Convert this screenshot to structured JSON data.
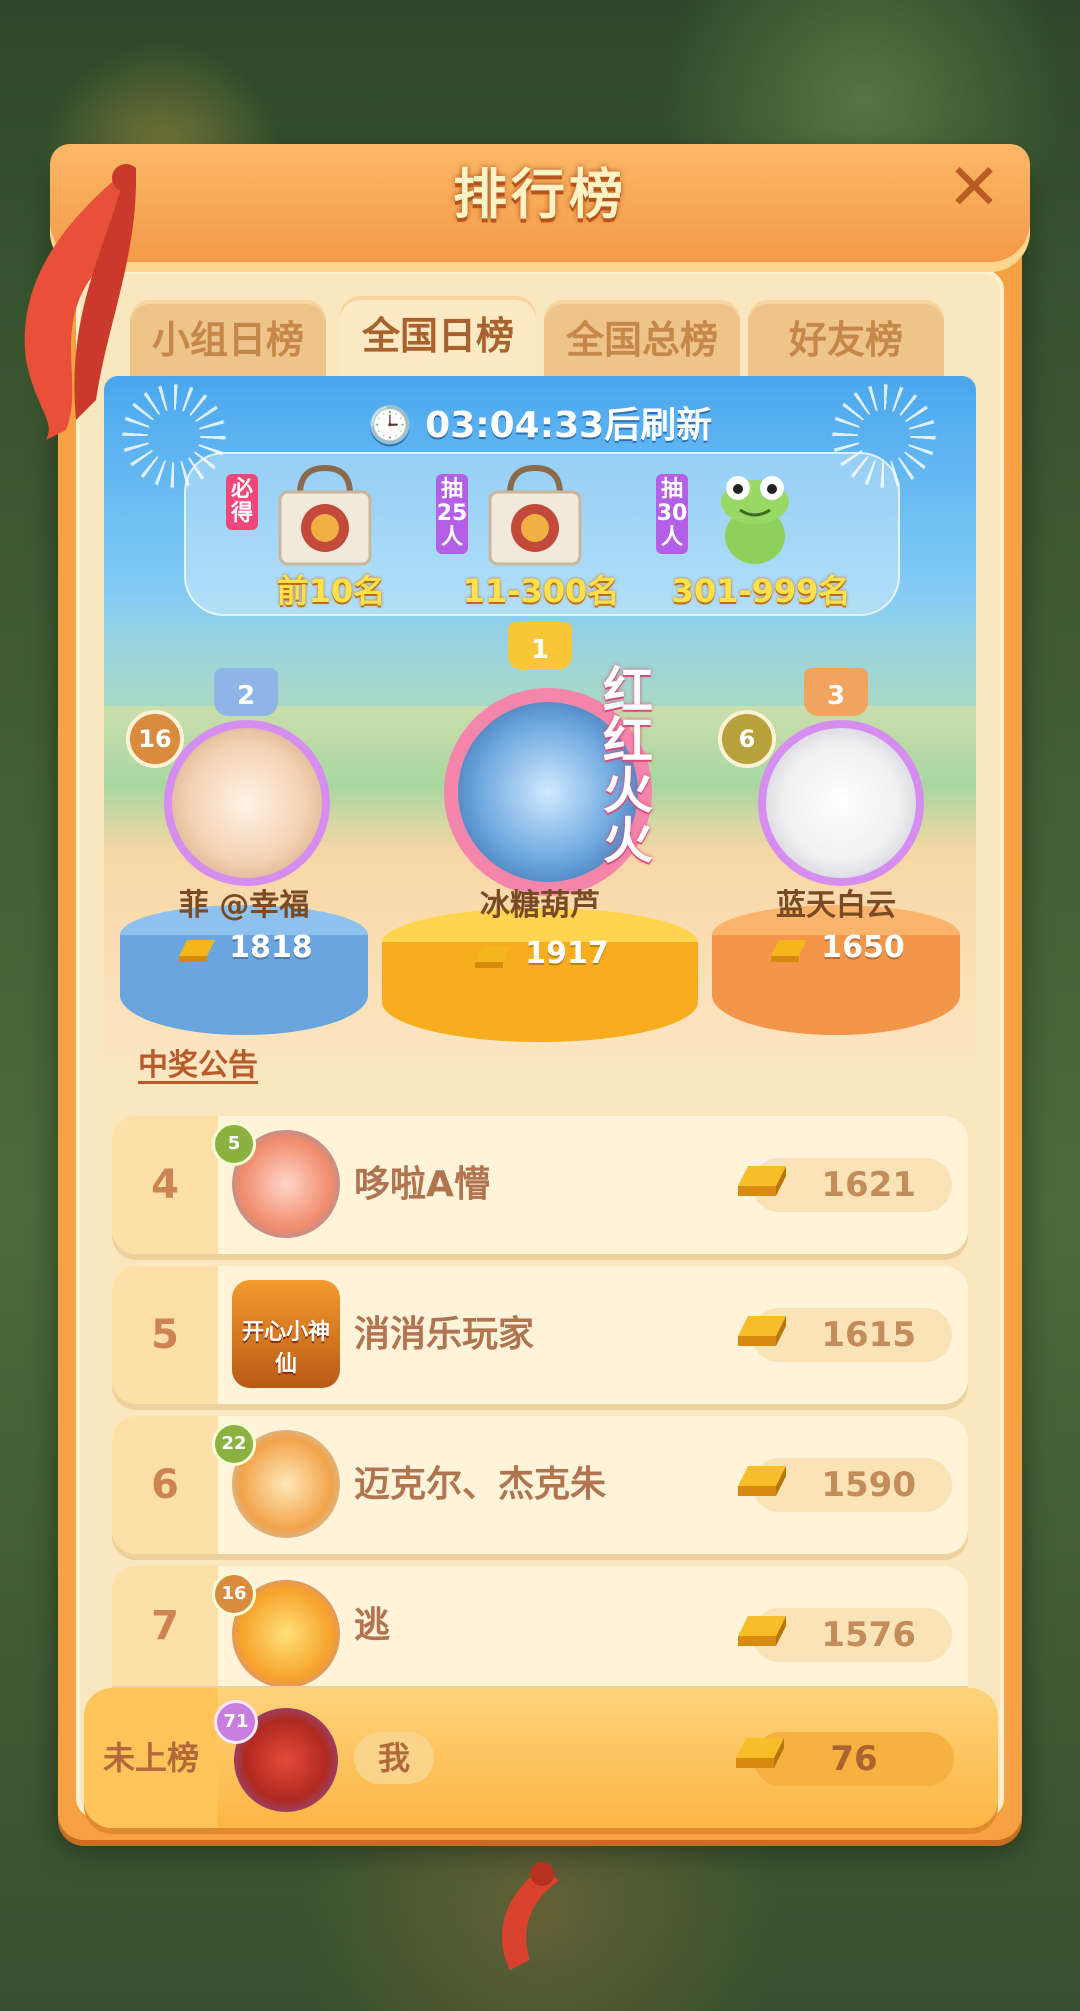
{
  "title": "排行榜",
  "tabs": [
    "小组日榜",
    "全国日榜",
    "全国总榜",
    "好友榜"
  ],
  "active_tab": "全国日榜",
  "refresh_timer": "03:04:33后刷新",
  "rewards": [
    {
      "tag": "必得",
      "label": "前10名",
      "item": "bag"
    },
    {
      "tag": "抽25人",
      "label": "11-300名",
      "item": "bag"
    },
    {
      "tag": "抽30人",
      "label": "301-999名",
      "item": "frog-plush"
    }
  ],
  "podium": [
    {
      "rank": "2",
      "level": "16",
      "name": "菲 @幸福",
      "score": "1818"
    },
    {
      "rank": "1",
      "name": "冰糖葫芦",
      "score": "1917",
      "frame_text": "红红火火"
    },
    {
      "rank": "3",
      "level": "6",
      "name": "蓝天白云",
      "score": "1650"
    }
  ],
  "notice_link": "中奖公告",
  "rows": [
    {
      "rank": "4",
      "level": "5",
      "name": "哆啦A懵",
      "score": "1621"
    },
    {
      "rank": "5",
      "level": "",
      "name": "消消乐玩家",
      "score": "1615",
      "avatar_text": "开心小神仙"
    },
    {
      "rank": "6",
      "level": "22",
      "name": "迈克尔、杰克朱",
      "score": "1590"
    },
    {
      "rank": "7",
      "level": "16",
      "name": "逃",
      "score": "1576"
    }
  ],
  "me": {
    "rank": "未上榜",
    "level": "71",
    "name": "我",
    "score": "76"
  },
  "colors": {
    "panel": "#f6a243",
    "accent_gold": "#ffe24a",
    "tab_active": "#fde9c3"
  }
}
